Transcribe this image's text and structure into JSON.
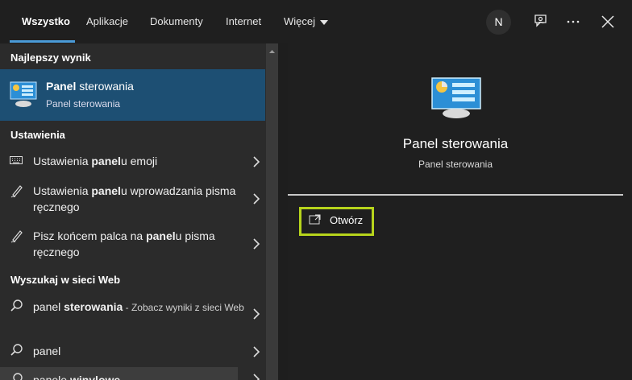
{
  "header": {
    "tabs": [
      {
        "label": "Wszystko",
        "active": true
      },
      {
        "label": "Aplikacje"
      },
      {
        "label": "Dokumenty"
      },
      {
        "label": "Internet"
      },
      {
        "label": "Więcej"
      }
    ],
    "avatar_initial": "N",
    "icons": [
      "feedback-icon",
      "more-options-icon",
      "close-icon"
    ]
  },
  "left": {
    "best_match_heading": "Najlepszy wynik",
    "best_match": {
      "title_bold": "Panel",
      "title_rest": " sterowania",
      "subtitle": "Panel sterowania",
      "icon": "control-panel-icon"
    },
    "settings_heading": "Ustawienia",
    "settings": [
      {
        "icon": "keyboard-icon",
        "pre": "Ustawienia ",
        "bold": "panel",
        "post": "u emoji"
      },
      {
        "icon": "pen-icon",
        "pre": "Ustawienia ",
        "bold": "panel",
        "post": "u wprowadzania pisma ręcznego"
      },
      {
        "icon": "pen-icon",
        "pre": "Pisz końcem palca na ",
        "bold": "panel",
        "post": "u pisma ręcznego"
      }
    ],
    "web_heading": "Wyszukaj w sieci Web",
    "web": [
      {
        "icon": "search-icon",
        "pre": "panel ",
        "bold": "sterowania",
        "post": "",
        "suffix": " - Zobacz wyniki z sieci Web"
      },
      {
        "icon": "search-icon",
        "pre": "panel",
        "bold": "",
        "post": ""
      },
      {
        "icon": "search-icon",
        "pre": "panele ",
        "bold": "winylowe",
        "post": ""
      }
    ]
  },
  "right": {
    "title": "Panel sterowania",
    "subtitle": "Panel sterowania",
    "open_label": "Otwórz"
  },
  "colors": {
    "accent": "#4a9bd8",
    "selected": "#1d4f73",
    "highlight": "#b7d41c"
  }
}
